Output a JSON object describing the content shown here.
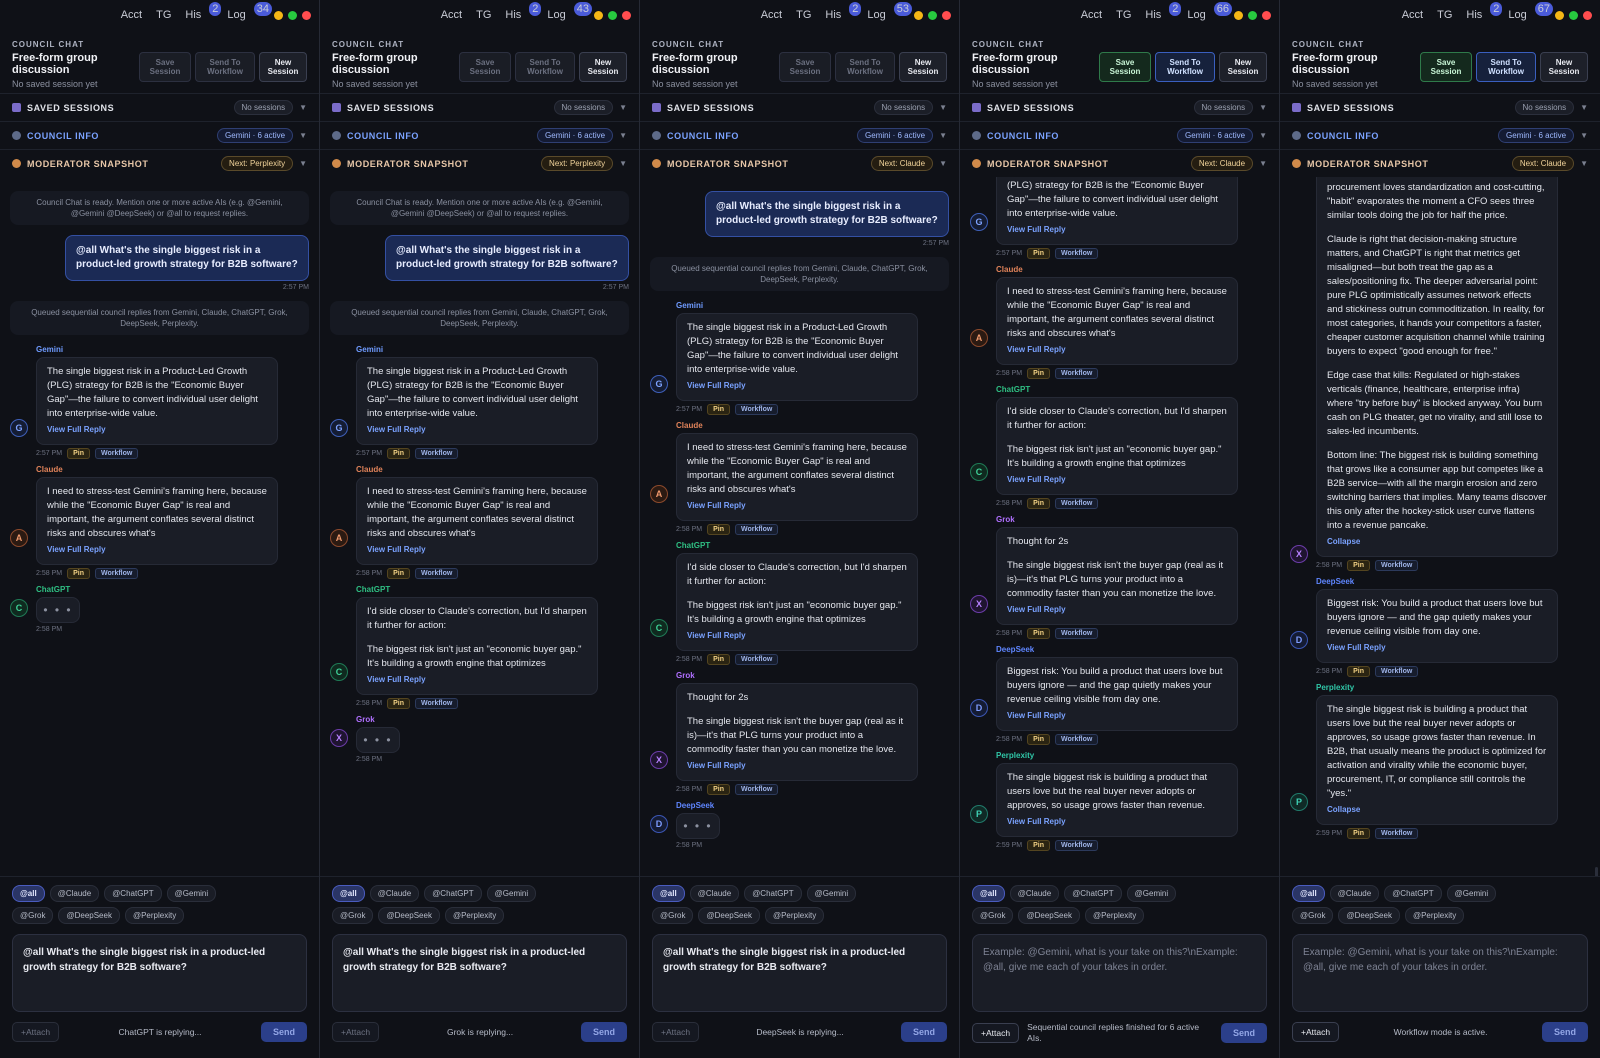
{
  "colors": {
    "accent": "#4a5bd9",
    "gemini": "#6f9bff",
    "claude": "#e0835a",
    "chatgpt": "#2fbf83",
    "grok": "#b070ff",
    "deepseek": "#5f86ff",
    "perplexity": "#30c7a8"
  },
  "topnav": {
    "acct": "Acct",
    "tg": "TG",
    "his": "His",
    "log": "Log"
  },
  "header": {
    "brand": "COUNCIL CHAT",
    "title": "Free-form group discussion",
    "sub": "No saved session yet",
    "save": "Save Session",
    "send_to_workflow": "Send To Workflow",
    "new_session": "New Session"
  },
  "sections": {
    "saved": "SAVED SESSIONS",
    "saved_pill": "No sessions",
    "council": "COUNCIL INFO",
    "council_pill": "Gemini · 6 active",
    "moderator": "MODERATOR SNAPSHOT"
  },
  "system": {
    "ready": "Council Chat is ready. Mention one or more active AIs (e.g. @Gemini, @Gemini @DeepSeek) or @all to request replies.",
    "queued": "Queued sequential council replies from Gemini, Claude, ChatGPT, Grok, DeepSeek, Perplexity."
  },
  "user": {
    "message": "@all What's the single biggest risk in a product-led growth strategy for B2B software?",
    "time": "2:57 PM"
  },
  "agents": {
    "gemini": {
      "name": "Gemini",
      "initial": "G",
      "text": "The single biggest risk in a Product-Led Growth (PLG) strategy for B2B is the \"Economic Buyer Gap\"—the failure to convert individual user delight into enterprise-wide value.",
      "text_tail": "(PLG) strategy for B2B is the \"Economic Buyer Gap\"—the failure to convert individual user delight into enterprise-wide value.",
      "time": "2:57 PM"
    },
    "claude": {
      "name": "Claude",
      "initial": "A",
      "text": "I need to stress-test Gemini's framing here, because while the \"Economic Buyer Gap\" is real and important, the argument conflates several distinct risks and obscures what's",
      "time": "2:58 PM"
    },
    "chatgpt": {
      "name": "ChatGPT",
      "initial": "C",
      "text1": "I'd side closer to Claude's correction, but I'd sharpen it further for action:",
      "text2": "The biggest risk isn't just an \"economic buyer gap.\" It's building a growth engine that optimizes",
      "time": "2:58 PM"
    },
    "grok": {
      "name": "Grok",
      "initial": "X",
      "text1": "Thought for 2s",
      "text2": "The single biggest risk isn't the buyer gap (real as it is)—it's that PLG turns your product into a commodity faster than you can monetize the love.",
      "time": "2:58 PM"
    },
    "grok_full": {
      "p0": "procurement loves standardization and cost-cutting, \"habit\" evaporates the moment a CFO sees three similar tools doing the job for half the price.",
      "p1": "Claude is right that decision-making structure matters, and ChatGPT is right that metrics get misaligned—but both treat the gap as a sales/positioning fix. The deeper adversarial point: pure PLG optimistically assumes network effects and stickiness outrun commoditization. In reality, for most categories, it hands your competitors a faster, cheaper customer acquisition channel while training buyers to expect \"good enough for free.\"",
      "p2": "Edge case that kills: Regulated or high-stakes verticals (finance, healthcare, enterprise infra) where \"try before buy\" is blocked anyway. You burn cash on PLG theater, get no virality, and still lose to sales-led incumbents.",
      "p3": "Bottom line: The biggest risk is building something that grows like a consumer app but competes like a B2B service—with all the margin erosion and zero switching barriers that implies. Many teams discover this only after the hockey-stick user curve flattens into a revenue pancake."
    },
    "deepseek": {
      "name": "DeepSeek",
      "initial": "D",
      "text": "Biggest risk: You build a product that users love but buyers ignore — and the gap quietly makes your revenue ceiling visible from day one.",
      "time": "2:58 PM"
    },
    "perplexity": {
      "name": "Perplexity",
      "initial": "P",
      "text_short": "The single biggest risk is building a product that users love but the real buyer never adopts or approves, so usage grows faster than revenue.",
      "text_long": "The single biggest risk is building a product that users love but the real buyer never adopts or approves, so usage grows faster than revenue. In B2B, that usually means the product is optimized for activation and virality while the economic buyer, procurement, IT, or compliance still controls the \"yes.\"",
      "time": "2:59 PM"
    }
  },
  "labels": {
    "view_full": "View Full Reply",
    "collapse": "Collapse",
    "pin": "Pin",
    "workflow": "Workflow",
    "typing": "• • •",
    "time_258": "2:58 PM"
  },
  "mentions": [
    "@all",
    "@Claude",
    "@ChatGPT",
    "@Gemini",
    "@Grok",
    "@DeepSeek",
    "@Perplexity"
  ],
  "composer": {
    "placeholder": "Example: @Gemini, what is your take on this?\\nExample: @all, give me each of your takes in order.",
    "attach": "+Attach",
    "send": "Send"
  },
  "panels": [
    {
      "badge_his": "2",
      "badge_log": "34",
      "moderator_pill": "Next: Perplexity",
      "status": "ChatGPT is replying..."
    },
    {
      "badge_his": "2",
      "badge_log": "43",
      "moderator_pill": "Next: Perplexity",
      "status": "Grok is replying..."
    },
    {
      "badge_his": "2",
      "badge_log": "53",
      "moderator_pill": "Next: Claude",
      "status": "DeepSeek is replying..."
    },
    {
      "badge_his": "2",
      "badge_log": "66",
      "moderator_pill": "Next: Claude",
      "status": "Sequential council replies finished for 6 active AIs."
    },
    {
      "badge_his": "2",
      "badge_log": "67",
      "moderator_pill": "Next: Claude",
      "status": "Workflow mode is active."
    }
  ]
}
